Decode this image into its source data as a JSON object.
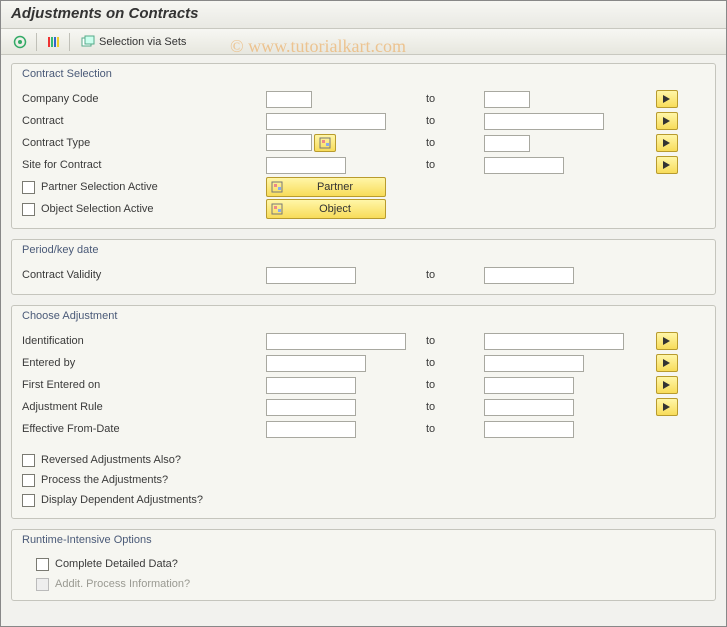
{
  "title": "Adjustments on Contracts",
  "toolbar": {
    "selection_via_sets": "Selection via Sets"
  },
  "watermark": "© www.tutorialkart.com",
  "to_label": "to",
  "groups": {
    "contract_selection": {
      "title": "Contract Selection",
      "company_code": "Company Code",
      "contract": "Contract",
      "contract_type": "Contract Type",
      "site_for_contract": "Site for Contract",
      "partner_selection_active": "Partner Selection Active",
      "object_selection_active": "Object Selection Active",
      "partner_btn": "Partner",
      "object_btn": "Object"
    },
    "period": {
      "title": "Period/key date",
      "contract_validity": "Contract Validity"
    },
    "choose_adj": {
      "title": "Choose Adjustment",
      "identification": "Identification",
      "entered_by": "Entered by",
      "first_entered_on": "First Entered on",
      "adjustment_rule": "Adjustment Rule",
      "effective_from": "Effective From-Date",
      "reversed": "Reversed Adjustments Also?",
      "process": "Process the Adjustments?",
      "display_dep": "Display Dependent Adjustments?"
    },
    "runtime": {
      "title": "Runtime-Intensive Options",
      "complete_detailed": "Complete Detailed Data?",
      "addit_process": "Addit. Process Information?"
    }
  }
}
